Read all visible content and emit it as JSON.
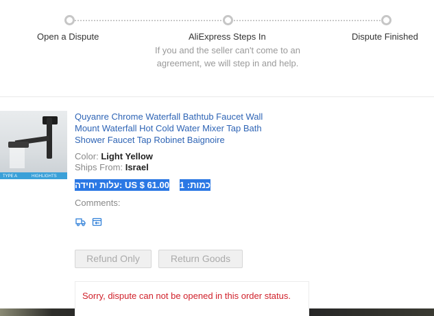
{
  "steps": [
    {
      "label": "Open a Dispute"
    },
    {
      "label": "AliExpress Steps In",
      "description": "If you and the seller can't come to an agreement, we will step in and help."
    },
    {
      "label": "Dispute Finished"
    }
  ],
  "product": {
    "title": "Quyanre Chrome Waterfall Bathtub Faucet Wall Mount Waterfall Hot Cold Water Mixer Tap Bath Shower Faucet Tap Robinet Baignoire",
    "color_label": "Color:",
    "color_value": "Light Yellow",
    "ships_label": "Ships From:",
    "ships_value": "Israel",
    "unit_price_text": "עלות יחידה: US $ 61.00",
    "quantity_text": "כמות: 1",
    "comments_label": "Comments:",
    "thumbnail_badges": [
      "TYPE A",
      "HIGHLIGHTS"
    ]
  },
  "icons": [
    "truck-icon",
    "order-icon"
  ],
  "buttons": {
    "refund_only": "Refund Only",
    "return_goods": "Return Goods"
  },
  "error": "Sorry, dispute can not be opened in this order status.",
  "colors": {
    "link": "#2e64b5",
    "error": "#d0202a",
    "selection": "#2b78e4"
  }
}
